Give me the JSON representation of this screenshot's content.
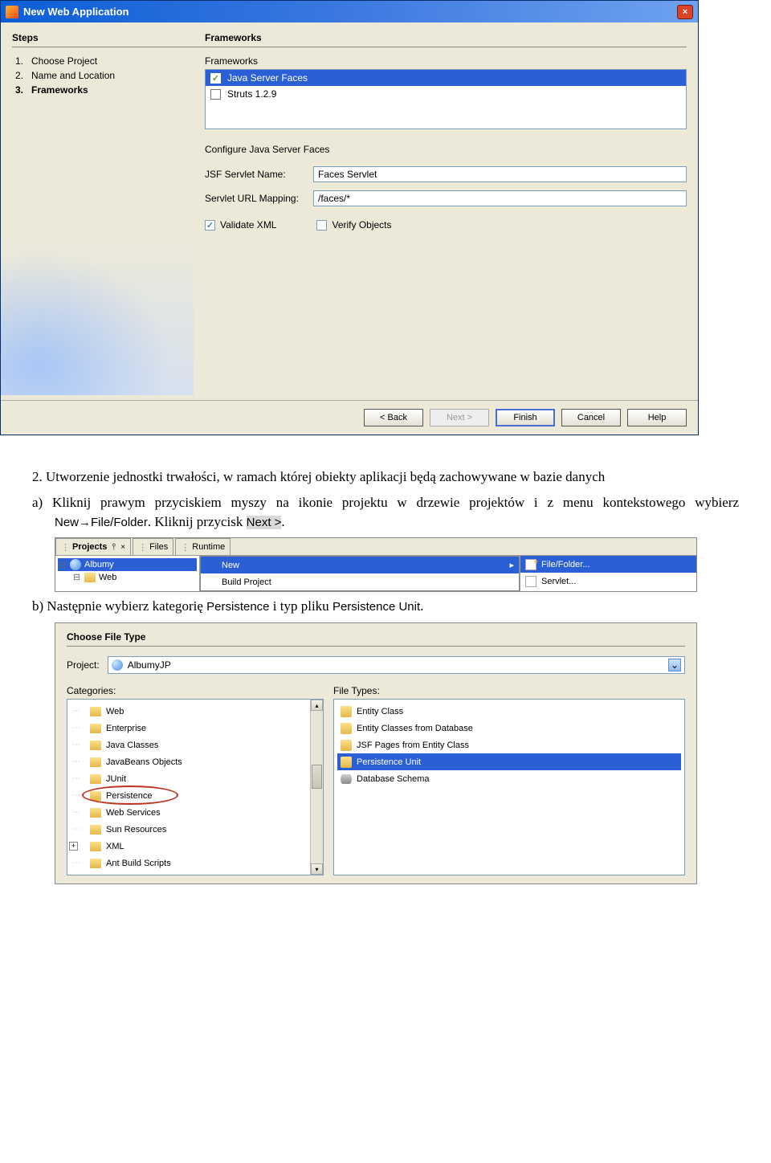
{
  "dialog1": {
    "title": "New Web Application",
    "steps_heading": "Steps",
    "steps": [
      {
        "num": "1.",
        "label": "Choose Project",
        "bold": false
      },
      {
        "num": "2.",
        "label": "Name and Location",
        "bold": false
      },
      {
        "num": "3.",
        "label": "Frameworks",
        "bold": true
      }
    ],
    "frameworks_heading": "Frameworks",
    "frameworks_label": "Frameworks",
    "framework_items": [
      {
        "label": "Java Server Faces",
        "checked": true,
        "selected": true
      },
      {
        "label": "Struts 1.2.9",
        "checked": false,
        "selected": false
      }
    ],
    "configure_label": "Configure Java Server Faces",
    "jsf_name_label": "JSF Servlet Name:",
    "jsf_name_value": "Faces Servlet",
    "url_mapping_label": "Servlet URL Mapping:",
    "url_mapping_value": "/faces/*",
    "validate_xml_label": "Validate XML",
    "verify_objects_label": "Verify Objects",
    "buttons": {
      "back": "< Back",
      "next": "Next >",
      "finish": "Finish",
      "cancel": "Cancel",
      "help": "Help"
    }
  },
  "instructions": {
    "p1_prefix": "2. Utworzenie jednostki trwałości, w ramach której obiekty aplikacji będą zachowywane w bazie danych",
    "a_prefix": "a)  ",
    "a_text": "Kliknij prawym przyciskiem myszy na ikonie projektu w drzewie projektów i z menu kontekstowego wybierz ",
    "a_sans1": "New→File/Folder",
    "a_mid": ". Kliknij przycisk ",
    "a_sans2": "Next >",
    "a_end": ".",
    "b_prefix": "b)  ",
    "b_text": "Następnie wybierz kategorię ",
    "b_sans1": "Persistence",
    "b_mid": " i typ pliku ",
    "b_sans2": "Persistence Unit",
    "b_end": "."
  },
  "shot2": {
    "tabs": {
      "projects": "Projects",
      "files": "Files",
      "runtime": "Runtime"
    },
    "btns": {
      "pin": "⫯",
      "close": "×"
    },
    "tree": {
      "root": "Albumy",
      "child": "Web"
    },
    "menu": {
      "new": "New",
      "build": "Build Project"
    },
    "submenu": {
      "filefolder": "File/Folder...",
      "servlet": "Servlet..."
    }
  },
  "shot3": {
    "title": "Choose File Type",
    "project_label": "Project:",
    "project_value": "AlbumyJP",
    "categories_label": "Categories:",
    "filetypes_label": "File Types:",
    "categories": [
      "Web",
      "Enterprise",
      "Java Classes",
      "JavaBeans Objects",
      "JUnit",
      "Persistence",
      "Web Services",
      "Sun Resources",
      "XML",
      "Ant Build Scripts"
    ],
    "filetypes": [
      {
        "label": "Entity Class",
        "sel": false
      },
      {
        "label": "Entity Classes from Database",
        "sel": false
      },
      {
        "label": "JSF Pages from Entity Class",
        "sel": false
      },
      {
        "label": "Persistence Unit",
        "sel": true
      },
      {
        "label": "Database Schema",
        "sel": false
      }
    ]
  }
}
